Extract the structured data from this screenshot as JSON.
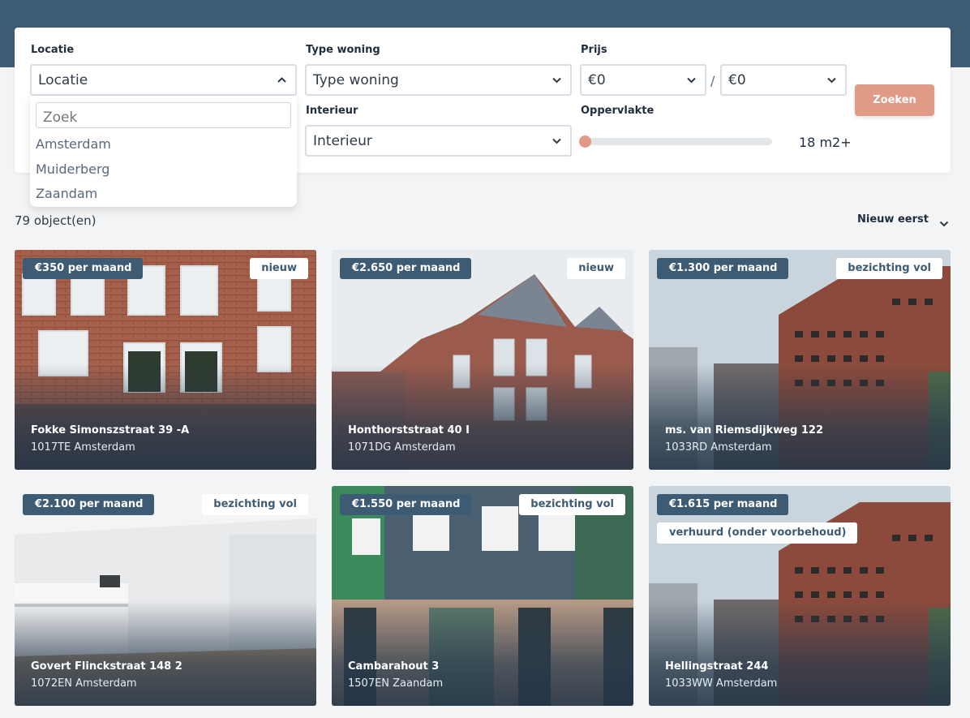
{
  "filters": {
    "location": {
      "label": "Locatie",
      "value": "Locatie"
    },
    "type": {
      "label": "Type woning",
      "value": "Type woning"
    },
    "price": {
      "label": "Prijs",
      "min": "€0",
      "separator": "/",
      "max": "€0"
    },
    "interior": {
      "label": "Interieur",
      "value": "Interieur"
    },
    "area": {
      "label": "Oppervlakte",
      "value": "18 m2+",
      "slider_fraction": 0
    },
    "search_button": "Zoeken"
  },
  "location_dropdown": {
    "search_placeholder": "Zoek",
    "options": [
      "Amsterdam",
      "Muiderberg",
      "Zaandam"
    ]
  },
  "results": {
    "count": "79 object(en)",
    "sort": "Nieuw eerst"
  },
  "listings": [
    {
      "price": "€350 per maand",
      "badge": "nieuw",
      "street": "Fokke Simonszstraat 39 -A",
      "city": "1017TE Amsterdam"
    },
    {
      "price": "€2.650 per maand",
      "badge": "nieuw",
      "street": "Honthorststraat 40 I",
      "city": "1071DG Amsterdam"
    },
    {
      "price": "€1.300 per maand",
      "badge": "bezichting vol",
      "street": "ms. van Riemsdijkweg 122",
      "city": "1033RD Amsterdam"
    },
    {
      "price": "€2.100 per maand",
      "badge": "bezichting vol",
      "street": "Govert Flinckstraat 148 2",
      "city": "1072EN Amsterdam"
    },
    {
      "price": "€1.550 per maand",
      "badge": "bezichting vol",
      "street": "Cambarahout 3",
      "city": "1507EN Zaandam"
    },
    {
      "price": "€1.615 per maand",
      "badge": "verhuurd (onder voorbehoud)",
      "street": "Hellingstraat 244",
      "city": "1033WW Amsterdam"
    }
  ],
  "colors": {
    "header": "#3e5b74",
    "accent": "#e09a85",
    "price_tag": "#3e5b74"
  }
}
